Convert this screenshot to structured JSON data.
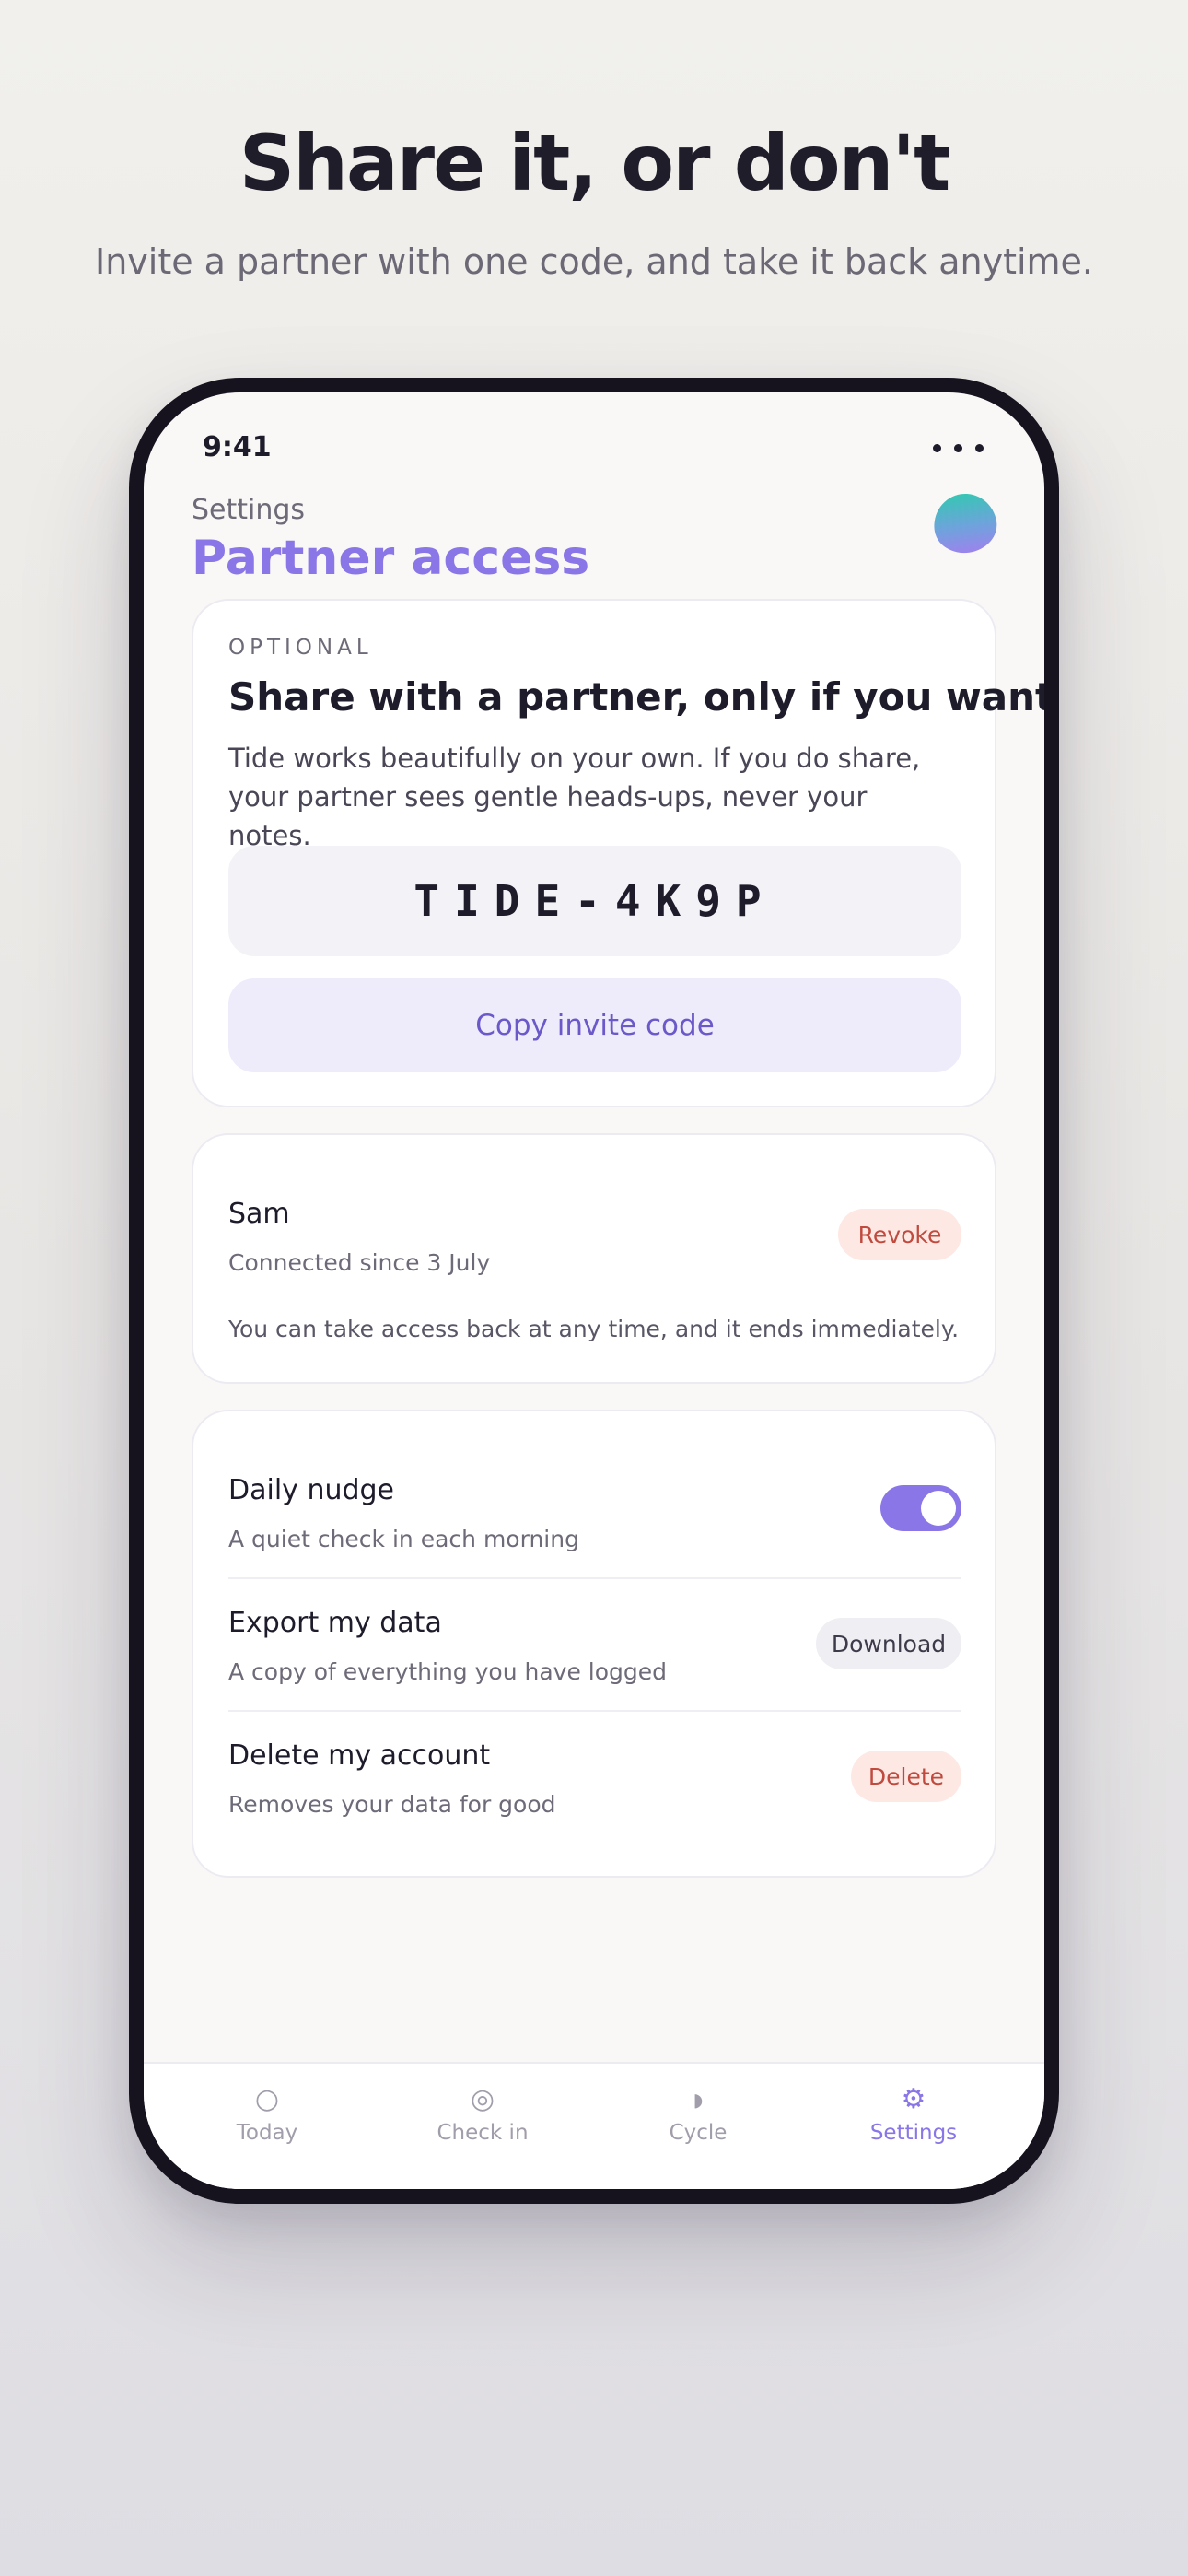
{
  "hero": {
    "title": "Share it, or don't",
    "subtitle": "Invite a partner with one code, and take it back anytime."
  },
  "status_bar": {
    "time": "9:41"
  },
  "header": {
    "breadcrumb": "Settings",
    "title": "Partner access",
    "logo_icon": "tide-logo-icon"
  },
  "share_card": {
    "eyebrow": "OPTIONAL",
    "heading": "Share with a partner, only if you want",
    "body": "Tide works beautifully on your own. If you do share, your partner sees gentle heads-ups, never your notes.",
    "invite_code": "TIDE-4K9P",
    "copy_button": "Copy invite code"
  },
  "partner_card": {
    "name": "Sam",
    "connected": "Connected since 3 July",
    "revoke_button": "Revoke",
    "note": "You can take access back at any time, and it ends immediately."
  },
  "settings": {
    "daily_nudge": {
      "title": "Daily nudge",
      "subtitle": "A quiet check in each morning",
      "enabled": true
    },
    "export": {
      "title": "Export my data",
      "subtitle": "A copy of everything you have logged",
      "button": "Download"
    },
    "delete": {
      "title": "Delete my account",
      "subtitle": "Removes your data for good",
      "button": "Delete"
    }
  },
  "colors": {
    "accent": "#8a76e6",
    "danger": "#c04a3e",
    "danger_bg": "#fde8e4",
    "screen_bg": "#faf8f6"
  },
  "tabbar": {
    "items": [
      {
        "label": "Today",
        "icon": "circle-icon",
        "glyph": "○",
        "active": false
      },
      {
        "label": "Check in",
        "icon": "target-icon",
        "glyph": "◎",
        "active": false
      },
      {
        "label": "Cycle",
        "icon": "half-moon-icon",
        "glyph": "◗",
        "active": false
      },
      {
        "label": "Settings",
        "icon": "gear-icon",
        "glyph": "⚙",
        "active": true
      }
    ]
  }
}
